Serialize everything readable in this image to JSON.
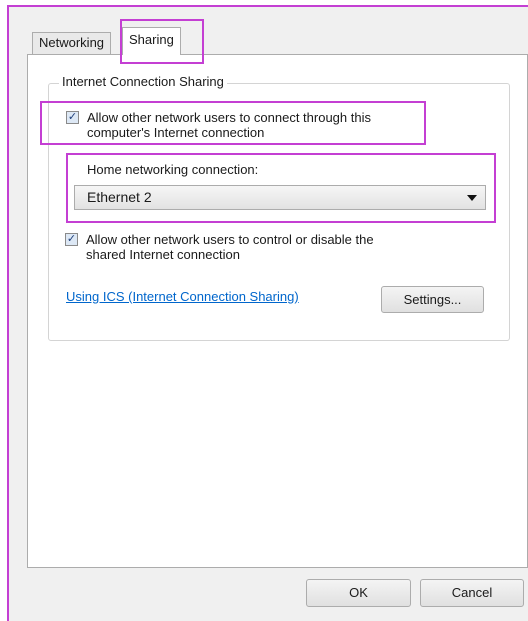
{
  "tabs": [
    {
      "label": "Networking",
      "selected": false
    },
    {
      "label": "Sharing",
      "selected": true
    }
  ],
  "ics": {
    "group_title": "Internet Connection Sharing",
    "allow_connect": {
      "checked": true,
      "line1": "Allow other network users to connect through this",
      "line2": "computer's Internet connection"
    },
    "home_network": {
      "label": "Home networking connection:",
      "selected": "Ethernet 2"
    },
    "allow_control": {
      "checked": true,
      "line1": "Allow other network users to control or disable the",
      "line2": "shared Internet connection"
    },
    "help_link": "Using ICS (Internet Connection Sharing)",
    "settings_button": "Settings..."
  },
  "footer": {
    "ok": "OK",
    "cancel": "Cancel"
  },
  "colors": {
    "highlight": "#c43fd3",
    "link": "#0066cc"
  },
  "icons": {
    "checkmark": "check-icon",
    "dropdown": "chevron-down-icon"
  }
}
